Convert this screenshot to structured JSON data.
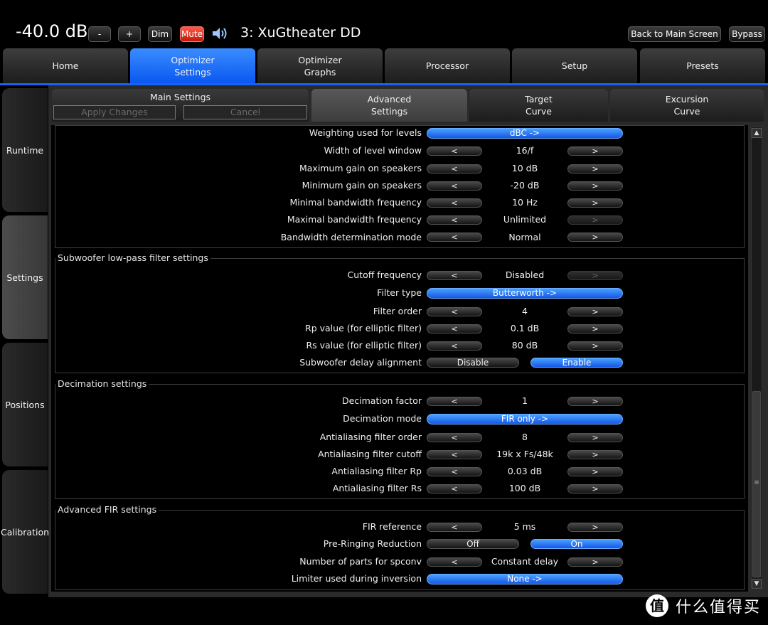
{
  "topbar": {
    "volume": "-40.0 dB",
    "minus": "-",
    "plus": "+",
    "dim": "Dim",
    "mute": "Mute",
    "preset": "3: XuGtheater DD",
    "back": "Back to Main Screen",
    "bypass": "Bypass"
  },
  "main_tabs": [
    "Home",
    "Optimizer\nSettings",
    "Optimizer\nGraphs",
    "Processor",
    "Setup",
    "Presets"
  ],
  "left_tabs": [
    "Runtime",
    "Settings",
    "Positions",
    "Calibration"
  ],
  "sub": {
    "main_settings": "Main Settings",
    "apply": "Apply Changes",
    "cancel": "Cancel",
    "advanced": "Advanced\nSettings",
    "target": "Target\nCurve",
    "excursion": "Excursion\nCurve"
  },
  "arrows": {
    "left": "<",
    "right": ">"
  },
  "levels": {
    "weighting_label": "Weighting used for levels",
    "weighting_value": "dBC ->",
    "width_label": "Width of level window",
    "width_value": "16/f",
    "maxgain_label": "Maximum gain on speakers",
    "maxgain_value": "10 dB",
    "mingain_label": "Minimum gain on speakers",
    "mingain_value": "-20 dB",
    "minbw_label": "Minimal bandwidth frequency",
    "minbw_value": "10 Hz",
    "maxbw_label": "Maximal bandwidth frequency",
    "maxbw_value": "Unlimited",
    "bwmode_label": "Bandwidth determination mode",
    "bwmode_value": "Normal"
  },
  "subwoofer": {
    "title": "Subwoofer low-pass filter settings",
    "cutoff_label": "Cutoff frequency",
    "cutoff_value": "Disabled",
    "type_label": "Filter type",
    "type_value": "Butterworth ->",
    "order_label": "Filter order",
    "order_value": "4",
    "rp_label": "Rp value (for elliptic filter)",
    "rp_value": "0.1 dB",
    "rs_label": "Rs value (for elliptic filter)",
    "rs_value": "80 dB",
    "delay_label": "Subwoofer delay alignment",
    "delay_off": "Disable",
    "delay_on": "Enable"
  },
  "decimation": {
    "title": "Decimation settings",
    "factor_label": "Decimation factor",
    "factor_value": "1",
    "mode_label": "Decimation mode",
    "mode_value": "FIR only ->",
    "aa_order_label": "Antialiasing filter order",
    "aa_order_value": "8",
    "aa_cutoff_label": "Antialiasing filter cutoff",
    "aa_cutoff_value": "19k x Fs/48k",
    "aa_rp_label": "Antialiasing filter Rp",
    "aa_rp_value": "0.03 dB",
    "aa_rs_label": "Antialiasing filter Rs",
    "aa_rs_value": "100 dB"
  },
  "fir": {
    "title": "Advanced FIR settings",
    "ref_label": "FIR reference",
    "ref_value": "5 ms",
    "prering_label": "Pre-Ringing Reduction",
    "prering_off": "Off",
    "prering_on": "On",
    "parts_label": "Number of parts for spconv",
    "parts_value": "Constant delay",
    "limiter_label": "Limiter used during inversion",
    "limiter_value": "None ->"
  },
  "scrollbar": {
    "up": "▲",
    "down": "▼",
    "grip": "≡"
  },
  "watermark": {
    "logo": "值",
    "text": "什么值得买"
  }
}
